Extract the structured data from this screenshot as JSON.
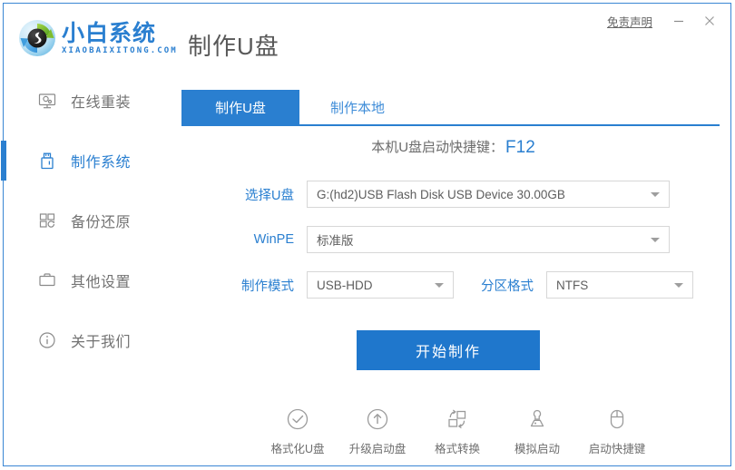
{
  "window": {
    "brand_cn": "小白系统",
    "brand_en": "XIAOBAIXITONG.COM",
    "page_title": "制作U盘",
    "disclaimer": "免责声明",
    "minimize": "—",
    "close": "✕",
    "accent_color": "#2a7fd0",
    "button_color": "#1f77cc"
  },
  "sidebar": {
    "items": [
      {
        "label": "在线重装",
        "icon": "monitor-icon",
        "active": false
      },
      {
        "label": "制作系统",
        "icon": "usb-drive-icon",
        "active": true
      },
      {
        "label": "备份还原",
        "icon": "backup-restore-icon",
        "active": false
      },
      {
        "label": "其他设置",
        "icon": "briefcase-icon",
        "active": false
      },
      {
        "label": "关于我们",
        "icon": "info-circle-icon",
        "active": false
      }
    ]
  },
  "main": {
    "tabs": [
      {
        "label": "制作U盘",
        "active": true
      },
      {
        "label": "制作本地",
        "active": false
      }
    ],
    "shortcut": {
      "text": "本机U盘启动快捷键：",
      "key": "F12"
    },
    "form": {
      "usb_label": "选择U盘",
      "usb_value": "G:(hd2)USB Flash Disk USB Device 30.00GB",
      "winpe_label": "WinPE",
      "winpe_value": "标准版",
      "mode_label": "制作模式",
      "mode_value": "USB-HDD",
      "partition_label": "分区格式",
      "partition_value": "NTFS"
    },
    "start_button": "开始制作",
    "tools": [
      {
        "label": "格式化U盘",
        "icon": "check-circle-icon"
      },
      {
        "label": "升级启动盘",
        "icon": "arrow-up-circle-icon"
      },
      {
        "label": "格式转换",
        "icon": "format-convert-icon"
      },
      {
        "label": "模拟启动",
        "icon": "joystick-icon"
      },
      {
        "label": "启动快捷键",
        "icon": "mouse-icon"
      }
    ]
  }
}
